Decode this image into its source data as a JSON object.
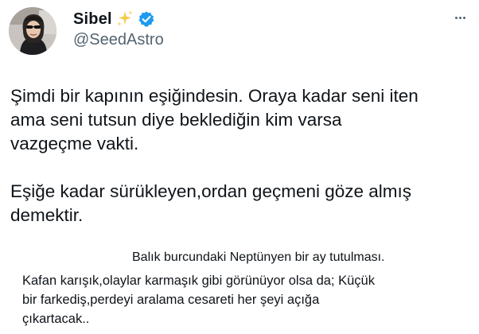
{
  "author": {
    "display_name": "Sibel",
    "handle": "@SeedAstro",
    "avatar_icon": "profile-photo",
    "name_emoji_icon": "sparkles-icon",
    "verified_icon": "verified-badge-icon",
    "verified_color": "#1d9bf0"
  },
  "menu": {
    "more_icon": "more-horizontal-icon"
  },
  "tweet": {
    "paragraph_1": [
      "Şimdi bir kapının eşiğindesin. Oraya kadar seni iten",
      "ama seni tutsun diye beklediğin kim varsa",
      "vazgeçme vakti."
    ],
    "paragraph_2": [
      "Eşiğe kadar sürükleyen,ordan geçmeni göze almış",
      "demektir."
    ]
  },
  "caption": {
    "line_1": "Balık burcundaki Neptünyen bir ay tutulması.",
    "line_2": "Kafan karışık,olaylar karmaşık gibi görünüyor olsa da; Küçük",
    "line_3": "bir farkediş,perdeyi aralama cesareti her şeyi açığa",
    "line_4": "çıkartacak.."
  },
  "colors": {
    "text_primary": "#0f1419",
    "text_secondary": "#536471",
    "background": "#ffffff"
  }
}
